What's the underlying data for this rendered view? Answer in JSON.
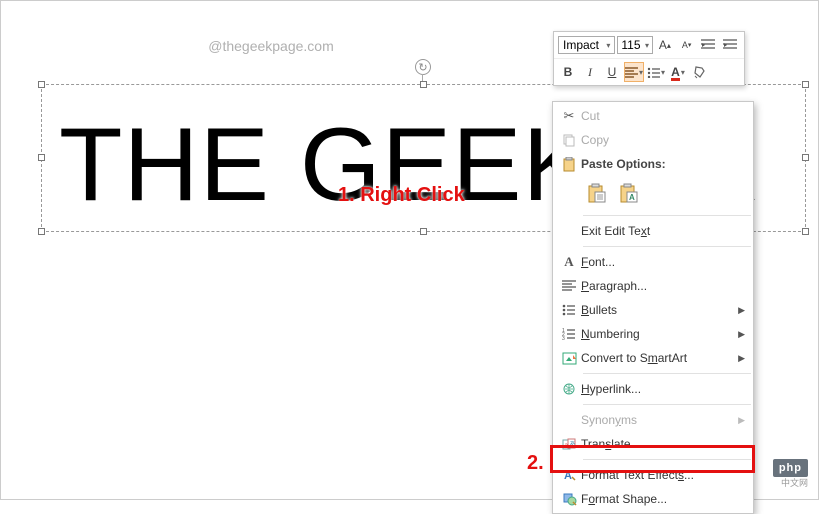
{
  "watermark": "@thegeekpage.com",
  "canvas_text": "THE GEEK PA",
  "annotation1": "1. Right Click",
  "annotation2": "2.",
  "toolbar": {
    "font_name": "Impact",
    "font_size": "115",
    "bold": "B",
    "italic": "I",
    "underline": "U"
  },
  "menu": {
    "cut": "Cut",
    "copy": "Copy",
    "paste_options": "Paste Options:",
    "exit_edit": "Exit Edit Text",
    "font": "Font...",
    "paragraph": "Paragraph...",
    "bullets": "Bullets",
    "numbering": "Numbering",
    "smartart": "Convert to SmartArt",
    "hyperlink": "Hyperlink...",
    "synonyms": "Synonyms",
    "translate": "Translate",
    "text_effects": "Format Text Effects...",
    "format_shape": "Format Shape..."
  },
  "footer": {
    "php": "php",
    "sub": "中文网"
  }
}
